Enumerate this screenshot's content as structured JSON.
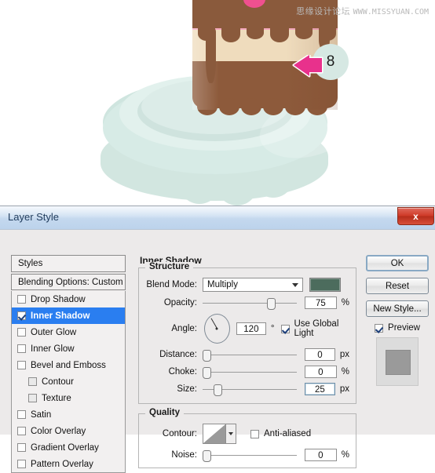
{
  "illustration": {
    "watermark_cn": "思缘设计论坛",
    "watermark_en": "WWW.MISSYUAN.COM",
    "callout_number": "8",
    "colors": {
      "pink_frosting": "#f4a8bd",
      "cream_layer": "#efdcbd",
      "chocolate": "#8d5a3b",
      "plate_mint": "#d7ebe6",
      "arrow_pink": "#e8318c",
      "badge_mint": "#d6e8e3"
    }
  },
  "dialog": {
    "title": "Layer Style",
    "close_label": "x"
  },
  "styles_panel": {
    "header": "Styles",
    "blending_options": "Blending Options: Custom",
    "effects": [
      {
        "label": "Drop Shadow",
        "checked": false,
        "selected": false,
        "indent": false
      },
      {
        "label": "Inner Shadow",
        "checked": true,
        "selected": true,
        "indent": false
      },
      {
        "label": "Outer Glow",
        "checked": false,
        "selected": false,
        "indent": false
      },
      {
        "label": "Inner Glow",
        "checked": false,
        "selected": false,
        "indent": false
      },
      {
        "label": "Bevel and Emboss",
        "checked": false,
        "selected": false,
        "indent": false
      },
      {
        "label": "Contour",
        "checked": false,
        "selected": false,
        "indent": true
      },
      {
        "label": "Texture",
        "checked": false,
        "selected": false,
        "indent": true
      },
      {
        "label": "Satin",
        "checked": false,
        "selected": false,
        "indent": false
      },
      {
        "label": "Color Overlay",
        "checked": false,
        "selected": false,
        "indent": false
      },
      {
        "label": "Gradient Overlay",
        "checked": false,
        "selected": false,
        "indent": false
      },
      {
        "label": "Pattern Overlay",
        "checked": false,
        "selected": false,
        "indent": false
      }
    ]
  },
  "inner_shadow": {
    "section_title": "Inner Shadow",
    "structure": {
      "legend": "Structure",
      "blend_mode_label": "Blend Mode:",
      "blend_mode_value": "Multiply",
      "shadow_color": "#4c6c5d",
      "opacity_label": "Opacity:",
      "opacity_value": "75",
      "opacity_unit": "%",
      "angle_label": "Angle:",
      "angle_value": "120",
      "angle_unit": "°",
      "use_global_light_label": "Use Global Light",
      "use_global_light_checked": true,
      "distance_label": "Distance:",
      "distance_value": "0",
      "distance_unit": "px",
      "choke_label": "Choke:",
      "choke_value": "0",
      "choke_unit": "%",
      "size_label": "Size:",
      "size_value": "25",
      "size_unit": "px"
    },
    "quality": {
      "legend": "Quality",
      "contour_label": "Contour:",
      "anti_aliased_label": "Anti-aliased",
      "anti_aliased_checked": false,
      "noise_label": "Noise:",
      "noise_value": "0",
      "noise_unit": "%"
    }
  },
  "buttons": {
    "ok": "OK",
    "reset": "Reset",
    "new_style": "New Style...",
    "preview_label": "Preview",
    "preview_checked": true
  }
}
